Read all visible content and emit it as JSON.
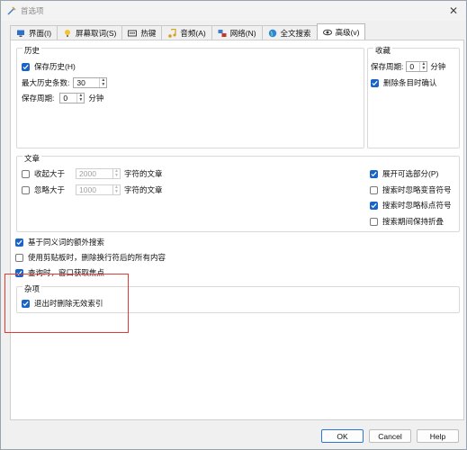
{
  "window": {
    "title": "首选项",
    "close_glyph": "✕"
  },
  "tabs": [
    {
      "label": "界面(I)",
      "icon": "monitor-icon"
    },
    {
      "label": "屏幕取词(S)",
      "icon": "bulb-icon"
    },
    {
      "label": "热键",
      "icon": "keyboard-icon"
    },
    {
      "label": "音频(A)",
      "icon": "music-icon"
    },
    {
      "label": "网络(N)",
      "icon": "network-icon"
    },
    {
      "label": "全文搜索",
      "icon": "globe-icon"
    },
    {
      "label": "高级(v)",
      "icon": "eye-icon"
    }
  ],
  "active_tab": "高级(v)",
  "history": {
    "title": "历史",
    "save_history": {
      "label": "保存历史(H)",
      "checked": true
    },
    "max_items_label": "最大历史条数:",
    "max_items_value": "30",
    "save_period_label": "保存周期:",
    "save_period_value": "0",
    "save_period_unit": "分钟"
  },
  "favorites": {
    "title": "收藏",
    "save_period_label": "保存周期:",
    "save_period_value": "0",
    "save_period_unit": "分钟",
    "confirm_delete": {
      "label": "删除条目时确认",
      "checked": true
    }
  },
  "articles": {
    "title": "文章",
    "collapse_larger": {
      "label": "收起大于",
      "checked": false,
      "value": "2000",
      "suffix": "字符的文章"
    },
    "ignore_larger": {
      "label": "忽略大于",
      "checked": false,
      "value": "1000",
      "suffix": "字符的文章"
    },
    "expand_optional": {
      "label": "展开可选部分(P)",
      "checked": true
    },
    "ignore_diacritics": {
      "label": "搜索时忽略变音符号",
      "checked": false
    },
    "ignore_punctuation": {
      "label": "搜索时忽略标点符号",
      "checked": true
    },
    "keep_folding": {
      "label": "搜索期间保持折叠",
      "checked": false
    }
  },
  "options": {
    "synonym_search": {
      "label": "基于同义词的额外搜索",
      "checked": true
    },
    "clipboard_newline": {
      "label": "使用剪贴板时，删除换行符后的所有内容",
      "checked": false
    },
    "focus_on_lookup": {
      "label": "查询时，窗口获取焦点",
      "checked": true
    }
  },
  "misc": {
    "title": "杂项",
    "delete_invalid_index": {
      "label": "退出时删除无效索引",
      "checked": true
    }
  },
  "buttons": {
    "ok": "OK",
    "cancel": "Cancel",
    "help": "Help"
  },
  "colors": {
    "accent": "#1a64c8",
    "highlight_box": "#e53935"
  }
}
